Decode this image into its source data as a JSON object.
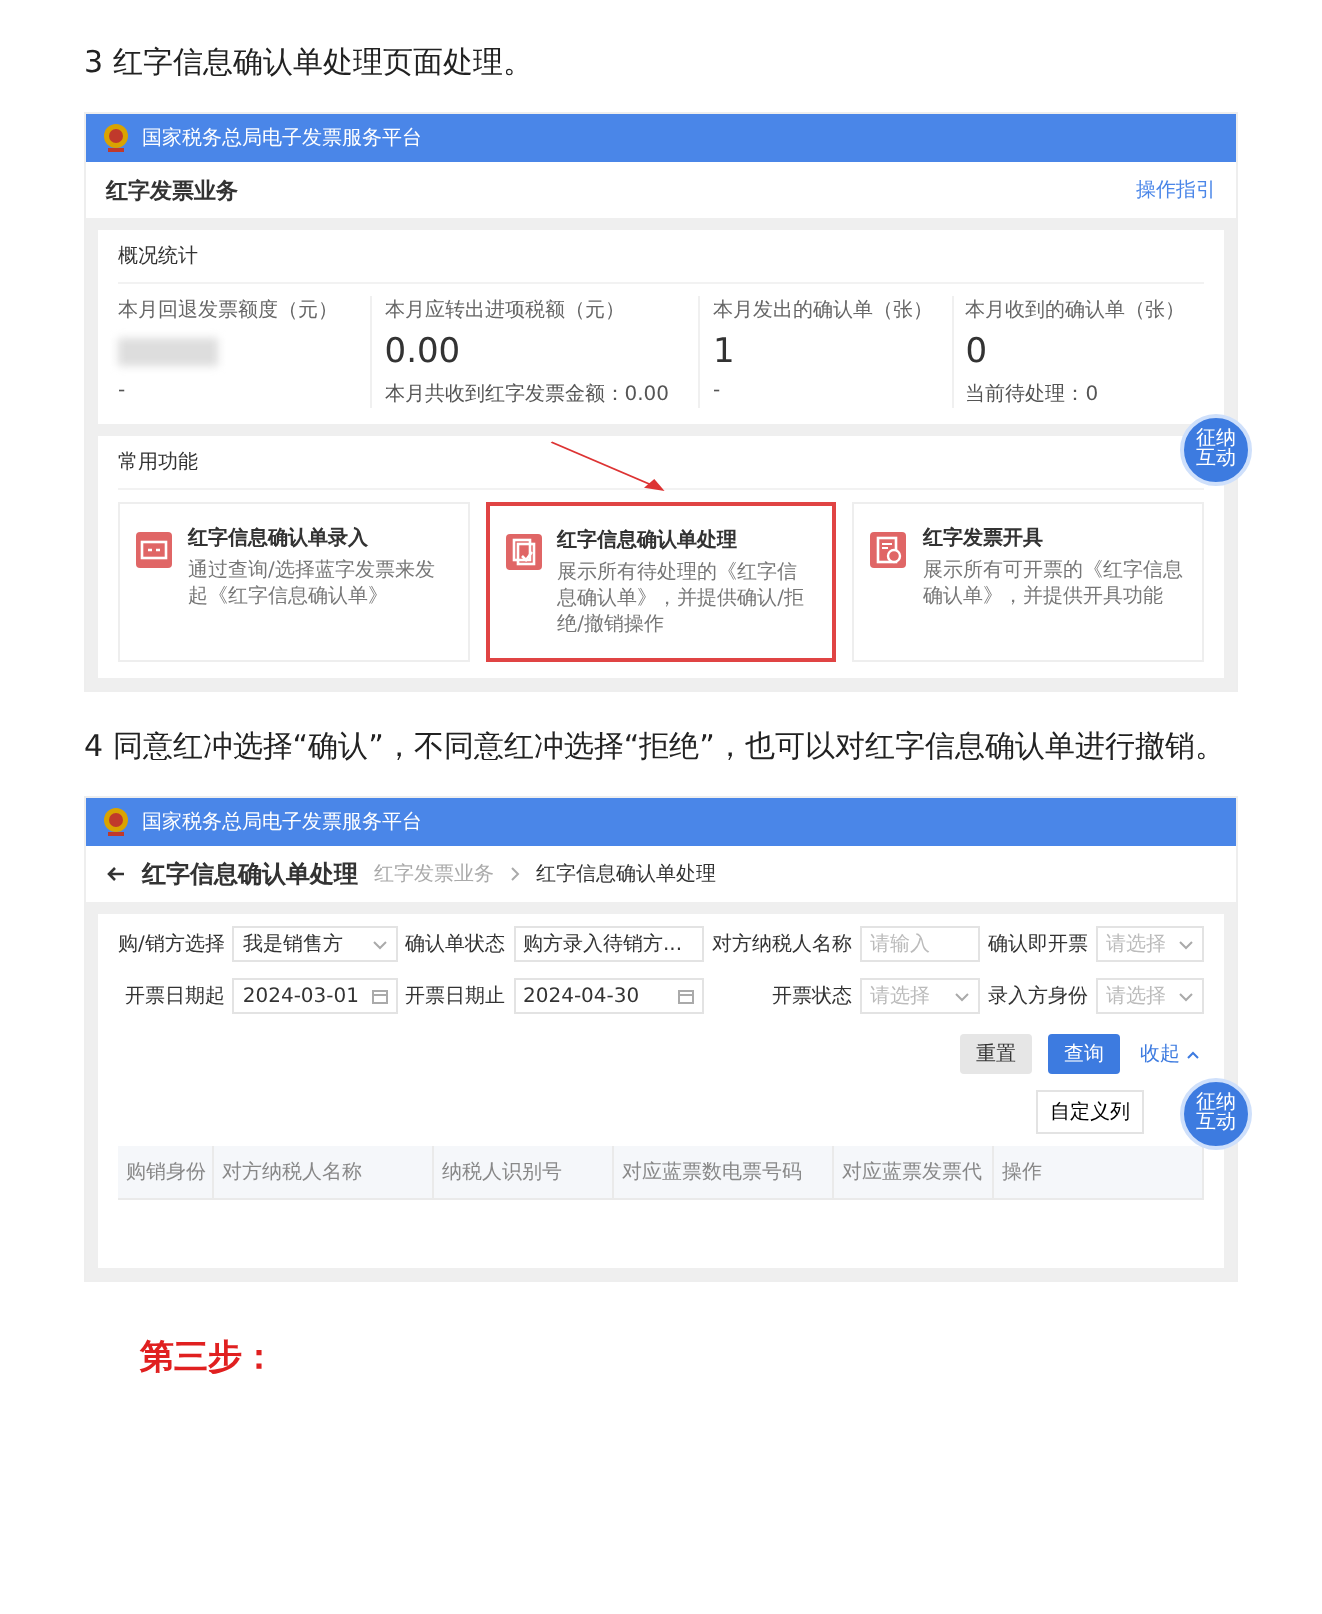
{
  "heading_3": "3 红字信息确认单处理页面处理。",
  "screenshot_1": {
    "platform_title": "国家税务总局电子发票服务平台",
    "page_title": "红字发票业务",
    "help_link": "操作指引",
    "overview": {
      "title": "概况统计",
      "stats": [
        {
          "label": "本月回退发票额度（元）",
          "redacted": true,
          "note": "-"
        },
        {
          "label": "本月应转出进项税额（元）",
          "value": "0.00",
          "note": "本月共收到红字发票金额：0.00"
        },
        {
          "label": "本月发出的确认单（张）",
          "value": "1",
          "note": "-"
        },
        {
          "label": "本月收到的确认单（张）",
          "value": "0",
          "note": "当前待处理：0"
        }
      ]
    },
    "functions": {
      "title": "常用功能",
      "cards": [
        {
          "title": "红字信息确认单录入",
          "desc": "通过查询/选择蓝字发票来发起《红字信息确认单》",
          "selected": false
        },
        {
          "title": "红字信息确认单处理",
          "desc": "展示所有待处理的《红字信息确认单》，并提供确认/拒绝/撤销操作",
          "selected": true
        },
        {
          "title": "红字发票开具",
          "desc": "展示所有可开票的《红字信息确认单》，并提供开具功能",
          "selected": false
        }
      ]
    },
    "assistant_badge": "征纳互动"
  },
  "heading_4": "4 同意红冲选择“确认”，不同意红冲选择“拒绝”，也可以对红字信息确认单进行撤销。",
  "screenshot_2": {
    "platform_title": "国家税务总局电子发票服务平台",
    "page_title": "红字信息确认单处理",
    "breadcrumb": [
      "红字发票业务",
      "红字信息确认单处理"
    ],
    "filters": [
      {
        "label": "购/销方选择",
        "kind": "select",
        "value": "我是销售方"
      },
      {
        "label": "确认单状态",
        "kind": "select",
        "value": "购方录入待销方..."
      },
      {
        "label": "对方纳税人名称",
        "kind": "input",
        "placeholder": "请输入"
      },
      {
        "label": "确认即开票",
        "kind": "select",
        "placeholder": "请选择"
      },
      {
        "label": "开票日期起",
        "kind": "date",
        "value": "2024-03-01"
      },
      {
        "label": "开票日期止",
        "kind": "date",
        "value": "2024-04-30"
      },
      {
        "label": "开票状态",
        "kind": "select",
        "placeholder": "请选择"
      },
      {
        "label": "录入方身份",
        "kind": "select",
        "placeholder": "请选择"
      }
    ],
    "buttons": [
      {
        "label": "重置",
        "kind": "default"
      },
      {
        "label": "查询",
        "kind": "primary"
      },
      {
        "label": "收起",
        "kind": "link"
      }
    ],
    "customize_button": "自定义列",
    "table": {
      "columns": [
        "购销身份",
        "对方纳税人名称",
        "纳税人识别号",
        "对应蓝票数电票号码",
        "对应蓝票发票代",
        "操作"
      ]
    },
    "assistant_badge": "征纳互动"
  },
  "step_label": "第三步："
}
